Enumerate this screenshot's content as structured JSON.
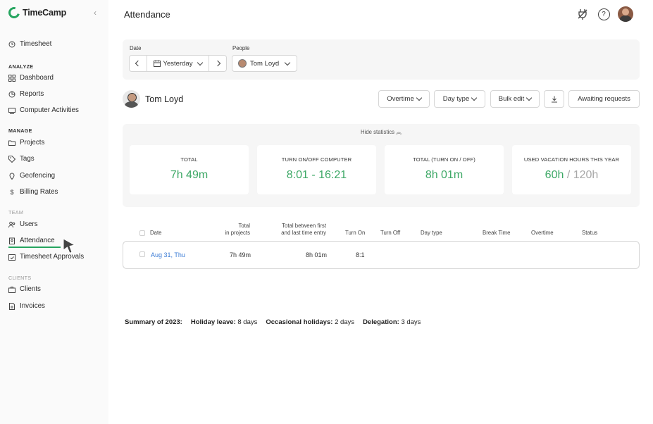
{
  "app": {
    "brand": "TimeCamp",
    "accent": "#25a55f"
  },
  "sidebar": {
    "timesheet": "Timesheet",
    "sections": {
      "analyze": "ANALYZE",
      "manage": "MANAGE",
      "team": "TEAM",
      "clients": "CLIENTS"
    },
    "items": {
      "dashboard": "Dashboard",
      "reports": "Reports",
      "computer_activities": "Computer Activities",
      "projects": "Projects",
      "tags": "Tags",
      "geofencing": "Geofencing",
      "billing_rates": "Billing Rates",
      "users": "Users",
      "attendance": "Attendance",
      "timesheet_approvals": "Timesheet Approvals",
      "clients": "Clients",
      "invoices": "Invoices"
    },
    "active": "attendance"
  },
  "header": {
    "title": "Attendance"
  },
  "filters": {
    "date_label": "Date",
    "date_value": "Yesterday",
    "people_label": "People",
    "people_value": "Tom Loyd"
  },
  "user": {
    "name": "Tom Loyd"
  },
  "toolbar": {
    "overtime": "Overtime",
    "day_type": "Day type",
    "bulk_edit": "Bulk edit",
    "awaiting_requests": "Awaiting requests"
  },
  "stats": {
    "toggle": "Hide statistics",
    "cards": [
      {
        "label": "TOTAL",
        "value": "7h 49m"
      },
      {
        "label": "TURN ON/OFF COMPUTER",
        "value": "8:01 - 16:21"
      },
      {
        "label": "TOTAL (TURN ON / OFF)",
        "value": "8h 01m"
      },
      {
        "label": "USED VACATION HOURS THIS YEAR",
        "value": "60h",
        "separator": "/",
        "limit": "120h"
      }
    ]
  },
  "table": {
    "headers": {
      "date": "Date",
      "total_projects_1": "Total",
      "total_projects_2": "in projects",
      "total_between_1": "Total between first",
      "total_between_2": "and last time entry",
      "turn_on": "Turn On",
      "turn_off": "Turn Off",
      "day_type": "Day type",
      "break_time": "Break Time",
      "overtime": "Overtime",
      "status": "Status"
    },
    "rows": [
      {
        "date": "Aug 31, Thu",
        "total_projects": "7h 49m",
        "total_between": "8h 01m",
        "turn_on": "8:1",
        "turn_off": "",
        "day_type": "",
        "break_time": "",
        "overtime": "",
        "status": ""
      }
    ]
  },
  "summary": {
    "title": "Summary of 2023:",
    "holiday_label": "Holiday leave:",
    "holiday_value": "8 days",
    "occasional_label": "Occasional holidays:",
    "occasional_value": "2 days",
    "delegation_label": "Delegation:",
    "delegation_value": "3 days"
  }
}
